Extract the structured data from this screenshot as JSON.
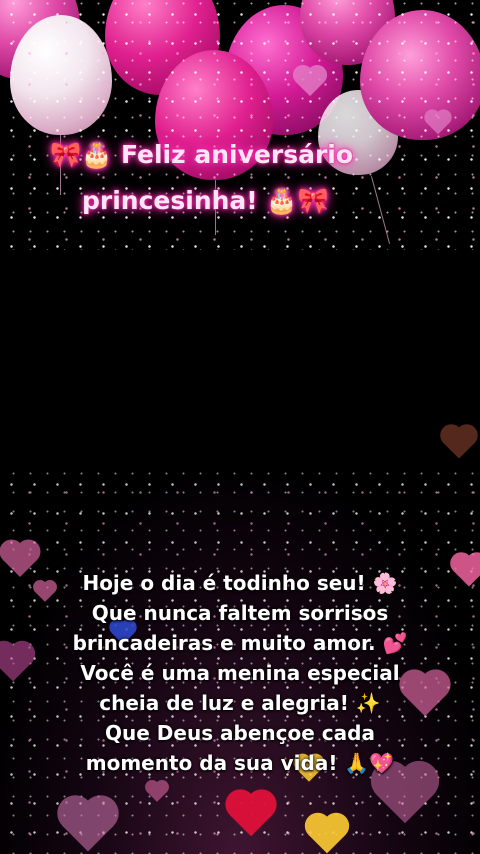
{
  "title": {
    "line1": "🎀🎂 Feliz aniversário",
    "line2": "princesinha! 🎂🎀"
  },
  "message": {
    "lines": [
      "Hoje o dia é todinho seu! 🌸",
      "Que nunca faltem sorrisos",
      "brincadeiras e muito amor. 💕",
      "Você é uma menina especial",
      "cheia de luz e alegria! ✨",
      "Que Deus abençoe cada",
      "momento da sua vida! 🙏💖"
    ]
  },
  "colors": {
    "background": "#000000",
    "title_glow": "#ff2fb0",
    "balloon_pink": "#e0208f",
    "balloon_white": "#f3e6ee",
    "heart_red": "#e0103a",
    "heart_gold": "#ffcc33",
    "heart_pink": "#d8659e"
  },
  "decorations": [
    "balloons",
    "glitter",
    "hearts",
    "sparkles"
  ]
}
